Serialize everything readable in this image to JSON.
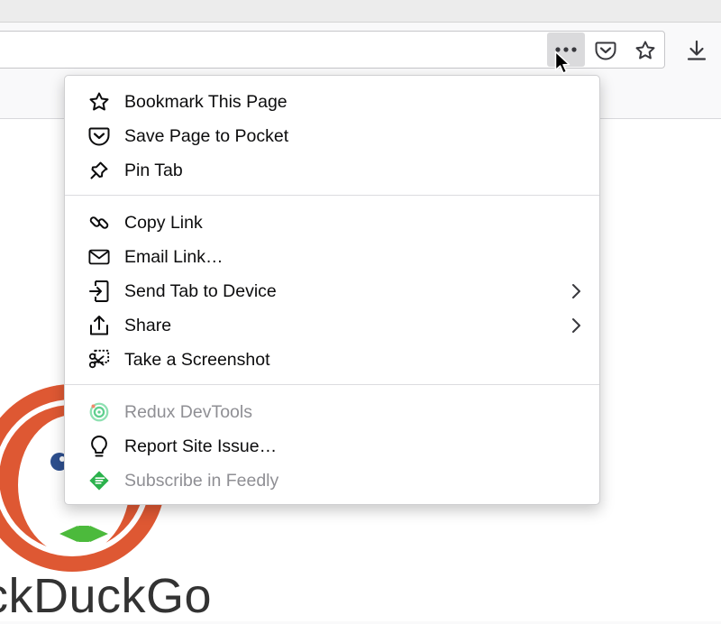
{
  "browser": {
    "toolbar": {
      "page_actions_icon": "ellipsis-icon",
      "pocket_icon": "pocket-icon",
      "bookmark_star_icon": "star-icon",
      "downloads_icon": "download-icon"
    },
    "page_wordmark": "ckDuckGo"
  },
  "menu": {
    "items": [
      {
        "label": "Bookmark This Page",
        "icon": "star-icon",
        "enabled": true
      },
      {
        "label": "Save Page to Pocket",
        "icon": "pocket-icon",
        "enabled": true
      },
      {
        "label": "Pin Tab",
        "icon": "pin-icon",
        "enabled": true
      },
      {
        "label": "Copy Link",
        "icon": "link-icon",
        "enabled": true
      },
      {
        "label": "Email Link…",
        "icon": "envelope-icon",
        "enabled": true
      },
      {
        "label": "Send Tab to Device",
        "icon": "send-tab-icon",
        "enabled": true,
        "submenu": true
      },
      {
        "label": "Share",
        "icon": "share-icon",
        "enabled": true,
        "submenu": true
      },
      {
        "label": "Take a Screenshot",
        "icon": "screenshot-icon",
        "enabled": true
      },
      {
        "label": "Redux DevTools",
        "icon": "redux-icon",
        "enabled": false
      },
      {
        "label": "Report Site Issue…",
        "icon": "lightbulb-icon",
        "enabled": true
      },
      {
        "label": "Subscribe in Feedly",
        "icon": "feedly-icon",
        "enabled": false
      }
    ]
  },
  "colors": {
    "menu_text": "#0c0c0d",
    "disabled_text": "#8f8f94",
    "ddg_orange": "#de5833",
    "feedly_green": "#2bb24c",
    "redux_green": "#5fd08f"
  }
}
